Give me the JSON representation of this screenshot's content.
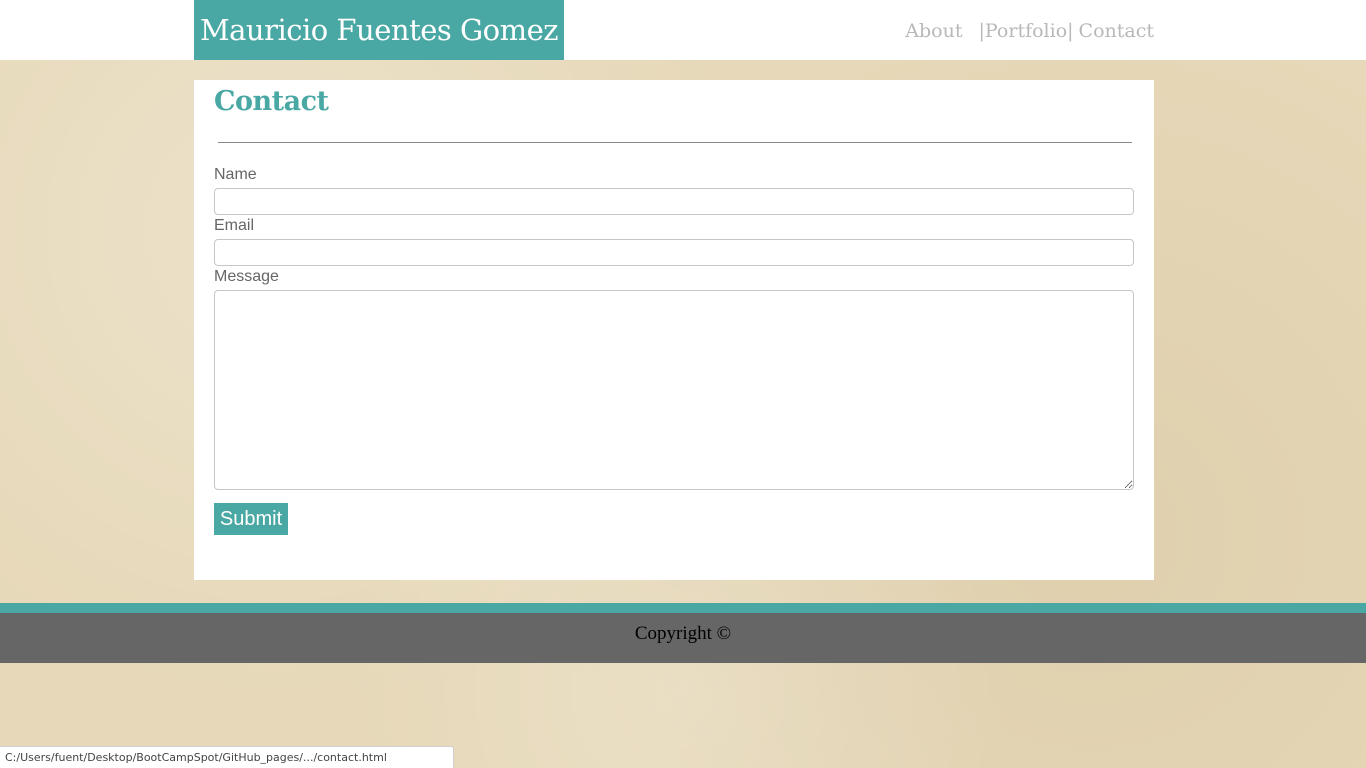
{
  "header": {
    "brand": "Mauricio Fuentes Gomez",
    "nav": {
      "about": "About",
      "separator": "|",
      "portfolio": "Portfolio",
      "contact": "Contact"
    }
  },
  "contact_form": {
    "title": "Contact",
    "name_label": "Name",
    "name_value": "",
    "email_label": "Email",
    "email_value": "",
    "message_label": "Message",
    "message_value": "",
    "submit_label": "Submit"
  },
  "footer": {
    "copyright": "Copyright ©"
  },
  "status_bar": {
    "url": "C:/Users/fuent/Desktop/BootCampSpot/GitHub_pages/.../contact.html"
  },
  "colors": {
    "accent": "#4aa8a4",
    "footer": "#666666",
    "nav_text": "#b8b8b8",
    "background": "#e6d8b8"
  }
}
